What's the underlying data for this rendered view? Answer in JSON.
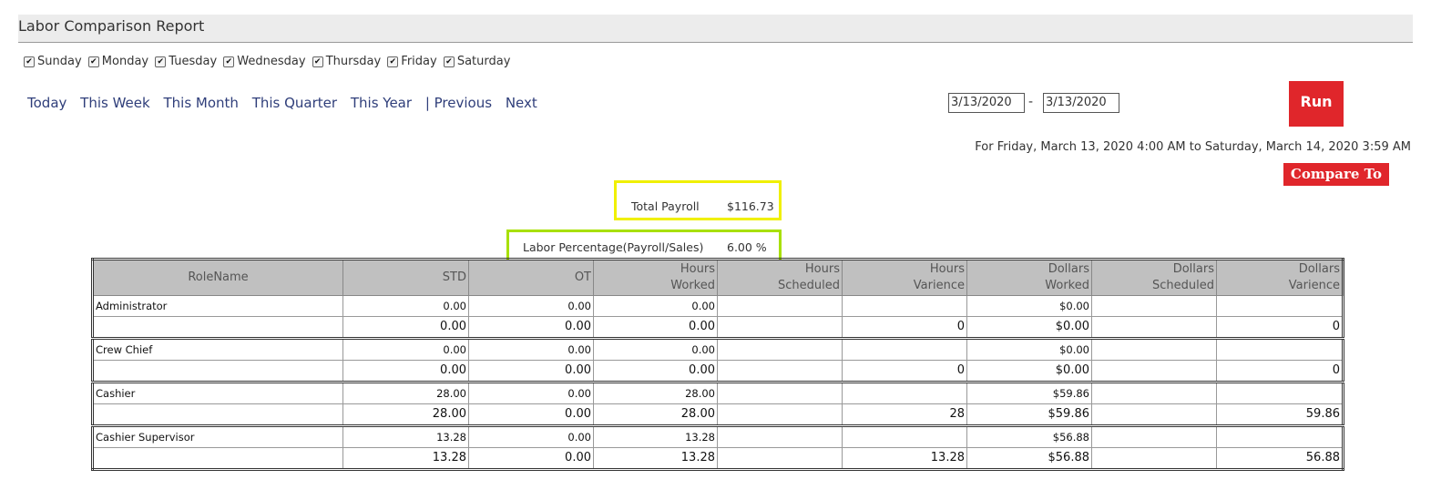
{
  "title": "Labor Comparison Report",
  "days": [
    "Sunday",
    "Monday",
    "Tuesday",
    "Wednesday",
    "Thursday",
    "Friday",
    "Saturday"
  ],
  "nav": {
    "today": "Today",
    "this_week": "This Week",
    "this_month": "This Month",
    "this_quarter": "This Quarter",
    "this_year": "This Year",
    "previous": "| Previous",
    "next": "Next"
  },
  "date_from": "3/13/2020",
  "date_separator": "-",
  "date_to": "3/13/2020",
  "run_label": "Run",
  "range_text": "For Friday, March 13, 2020 4:00 AM to Saturday, March 14, 2020 3:59 AM",
  "compare_label": "Compare To",
  "summary": {
    "total_payroll_label": "Total Payroll",
    "total_payroll_value": "$116.73",
    "labor_pct_label": "Labor Percentage(Payroll/Sales)",
    "labor_pct_value": "6.00 %"
  },
  "table": {
    "headers": [
      [
        "RoleName"
      ],
      [
        "STD"
      ],
      [
        "OT"
      ],
      [
        "Hours",
        "Worked"
      ],
      [
        "Hours",
        "Scheduled"
      ],
      [
        "Hours",
        "Varience"
      ],
      [
        "Dollars",
        "Worked"
      ],
      [
        "Dollars",
        "Scheduled"
      ],
      [
        "Dollars",
        "Varience"
      ]
    ],
    "rows": [
      [
        "Administrator",
        "0.00",
        "0.00",
        "0.00",
        "",
        "",
        "$0.00",
        "",
        ""
      ],
      [
        "",
        "0.00",
        "0.00",
        "0.00",
        "",
        "0",
        "$0.00",
        "",
        "0"
      ],
      [
        "Crew Chief",
        "0.00",
        "0.00",
        "0.00",
        "",
        "",
        "$0.00",
        "",
        ""
      ],
      [
        "",
        "0.00",
        "0.00",
        "0.00",
        "",
        "0",
        "$0.00",
        "",
        "0"
      ],
      [
        "Cashier",
        "28.00",
        "0.00",
        "28.00",
        "",
        "",
        "$59.86",
        "",
        ""
      ],
      [
        "",
        "28.00",
        "0.00",
        "28.00",
        "",
        "28",
        "$59.86",
        "",
        "59.86"
      ],
      [
        "Cashier Supervisor",
        "13.28",
        "0.00",
        "13.28",
        "",
        "",
        "$56.88",
        "",
        ""
      ],
      [
        "",
        "13.28",
        "0.00",
        "13.28",
        "",
        "13.28",
        "$56.88",
        "",
        "56.88"
      ]
    ]
  }
}
